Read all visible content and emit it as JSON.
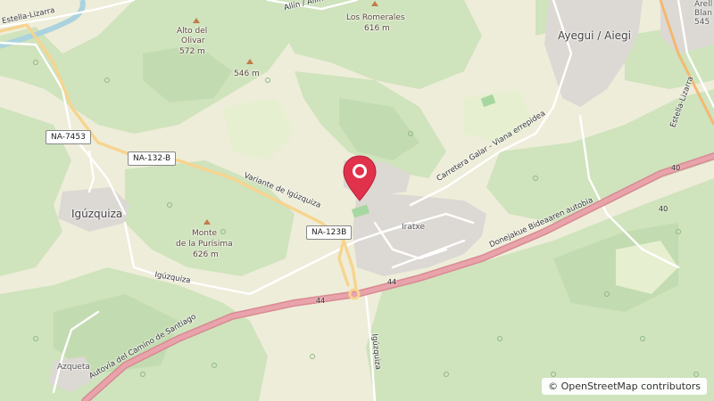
{
  "map": {
    "places": {
      "ayegui": "Ayegui / Aiegi",
      "iguzquiza": "Igúzquiza",
      "iratxe": "Iratxe",
      "azqueta": "Azqueta",
      "arellano": "Arell",
      "arellano2": "Blan",
      "arellano3": "545"
    },
    "peaks": {
      "romerales_name": "Los Romerales",
      "romerales_elev": "616 m",
      "olivar_name1": "Alto del",
      "olivar_name2": "Olivar",
      "olivar_elev": "572 m",
      "unnamed_elev": "546 m",
      "purisima_name1": "Monte",
      "purisima_name2": "de la Purísima",
      "purisima_elev": "626 m"
    },
    "roads": {
      "estella_lizarra_nw": "Estella-Lizarra",
      "variante": "Variante de Igúzquiza",
      "iguzquiza_road": "Igúzquiza",
      "iguzquiza_south": "Igúzquiza",
      "carretera": "Carretera Galar - Viana errepidea",
      "autobia": "Donejakue Bideaaren autobia",
      "autovia": "Autovía del Camino de Santiago",
      "estella_lizarra_ne": "Estella-Lizarra",
      "allin": "Allín / Allin",
      "motorway_num_1": "40",
      "motorway_num_2": "44",
      "motorway_num_3": "44",
      "motorway_num_4": "40"
    },
    "shields": {
      "na7453": "NA-7453",
      "na132b": "NA-132-B",
      "na123b": "NA-123B"
    },
    "attribution": "© OpenStreetMap contributors"
  }
}
